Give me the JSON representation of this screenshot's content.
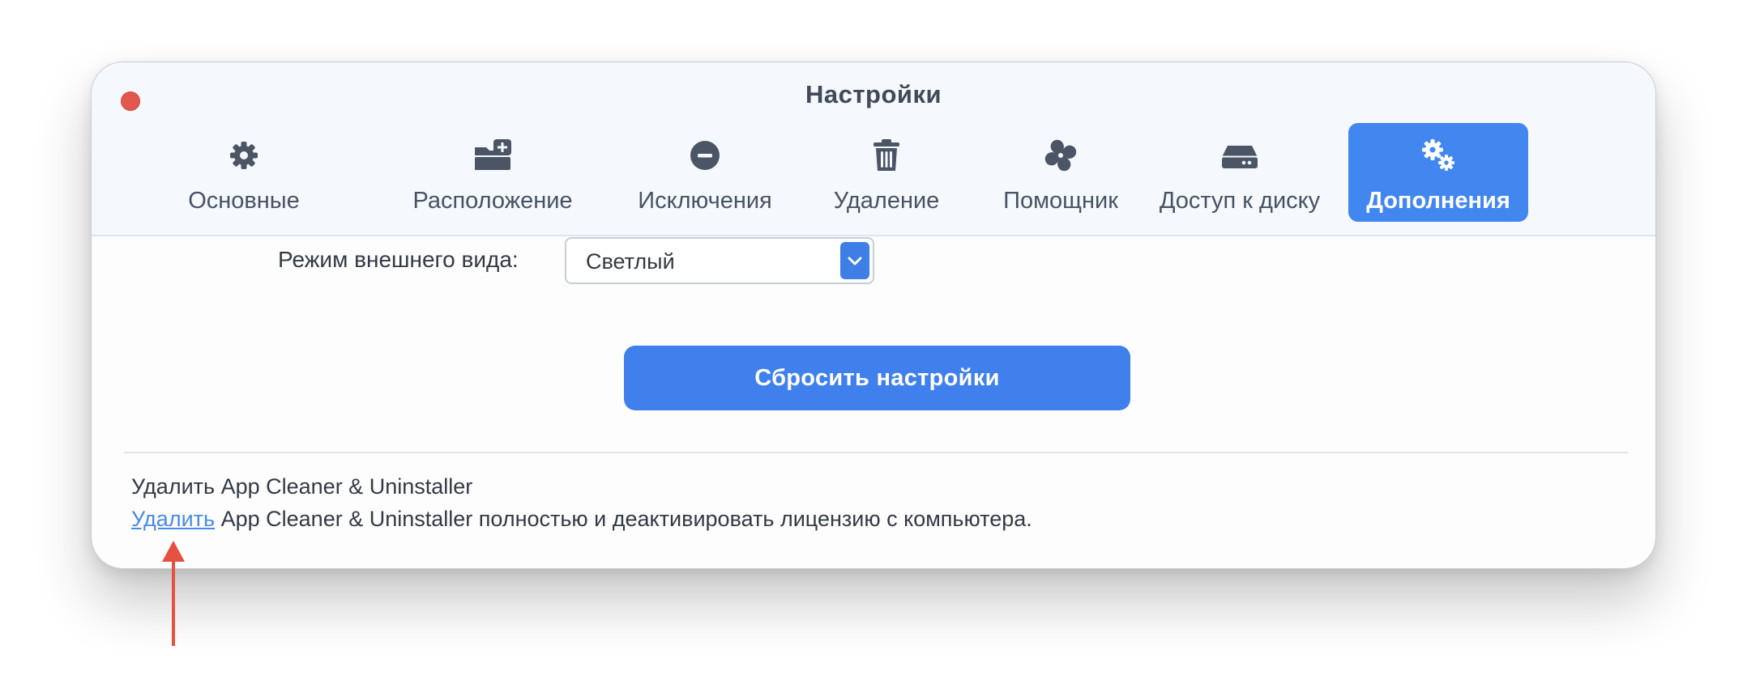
{
  "window": {
    "title": "Настройки"
  },
  "tabs": [
    {
      "label": "Основные",
      "icon": "gear-icon"
    },
    {
      "label": "Расположение",
      "icon": "folder-add-icon"
    },
    {
      "label": "Исключения",
      "icon": "minus-circle-icon"
    },
    {
      "label": "Удаление",
      "icon": "trash-icon"
    },
    {
      "label": "Помощник",
      "icon": "pinwheel-icon"
    },
    {
      "label": "Доступ к диску",
      "icon": "hard-drive-icon"
    },
    {
      "label": "Дополнения",
      "icon": "gears-icon",
      "active": true
    }
  ],
  "appearance": {
    "label": "Режим внешнего вида:",
    "selected": "Светлый"
  },
  "reset_button": "Сбросить настройки",
  "uninstall": {
    "title": "Удалить App Cleaner & Uninstaller",
    "link": "Удалить",
    "description": "App Cleaner & Uninstaller полностью и деактивировать лицензию с компьютера."
  },
  "colors": {
    "accent": "#4287f0",
    "close": "#e2584e",
    "annotation_arrow": "#e4513f",
    "link": "#4a8ae8"
  }
}
